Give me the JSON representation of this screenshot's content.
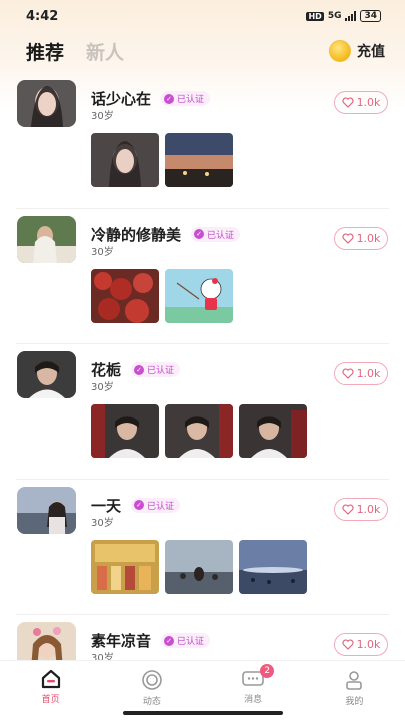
{
  "status_bar": {
    "time": "4:42",
    "network": "5G",
    "hd": "HD",
    "battery": "34"
  },
  "header": {
    "tabs": [
      "推荐",
      "新人"
    ],
    "recharge_label": "充值"
  },
  "verified_label": "已认证",
  "users": [
    {
      "name": "话少心在",
      "age": "30岁",
      "likes": "1.0k",
      "photo_count": 2
    },
    {
      "name": "冷静的修静美",
      "age": "30岁",
      "likes": "1.0k",
      "photo_count": 2
    },
    {
      "name": "花栀",
      "age": "30岁",
      "likes": "1.0k",
      "photo_count": 3
    },
    {
      "name": "一天",
      "age": "30岁",
      "likes": "1.0k",
      "photo_count": 3
    },
    {
      "name": "素年凉音",
      "age": "30岁",
      "likes": "1.0k",
      "photo_count": 0
    }
  ],
  "tabbar": {
    "items": [
      {
        "label": "首页",
        "icon": "home-icon",
        "active": true
      },
      {
        "label": "动态",
        "icon": "moments-icon",
        "active": false
      },
      {
        "label": "消息",
        "icon": "message-icon",
        "active": false
      },
      {
        "label": "我的",
        "icon": "profile-icon",
        "active": false
      }
    ],
    "message_badge": "2"
  },
  "colors": {
    "accent": "#e0486c",
    "verify": "#c148c9",
    "like": "#e06681"
  }
}
